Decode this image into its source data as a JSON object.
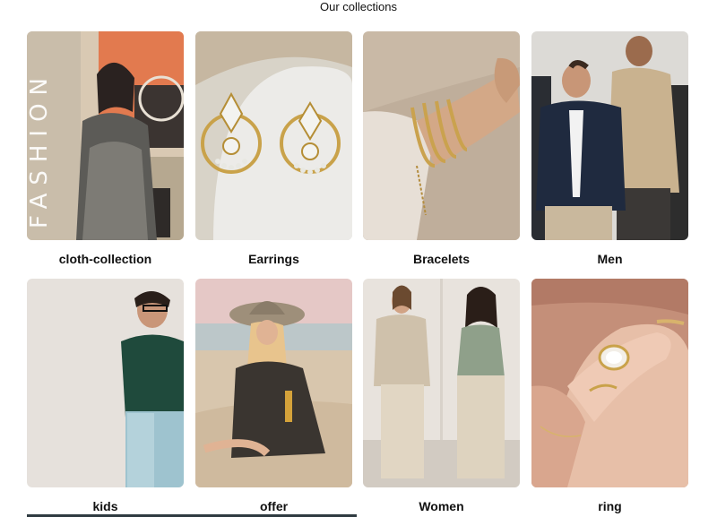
{
  "section": {
    "title": "Our collections"
  },
  "collections": [
    {
      "label": "cloth-collection",
      "image": "fashion-collage-photo",
      "overlay_text": "FASHION"
    },
    {
      "label": "Earrings",
      "image": "gold-diamond-earrings-photo"
    },
    {
      "label": "Bracelets",
      "image": "gold-bracelets-wrist-photo"
    },
    {
      "label": "Men",
      "image": "men-fashion-photo"
    },
    {
      "label": "kids",
      "image": "boy-green-sweater-photo"
    },
    {
      "label": "offer",
      "image": "woman-beach-hat-photo"
    },
    {
      "label": "Women",
      "image": "women-outfits-photo"
    },
    {
      "label": "ring",
      "image": "diamond-ring-hand-photo"
    }
  ],
  "colors": {
    "background": "#ffffff",
    "text": "#111111"
  }
}
